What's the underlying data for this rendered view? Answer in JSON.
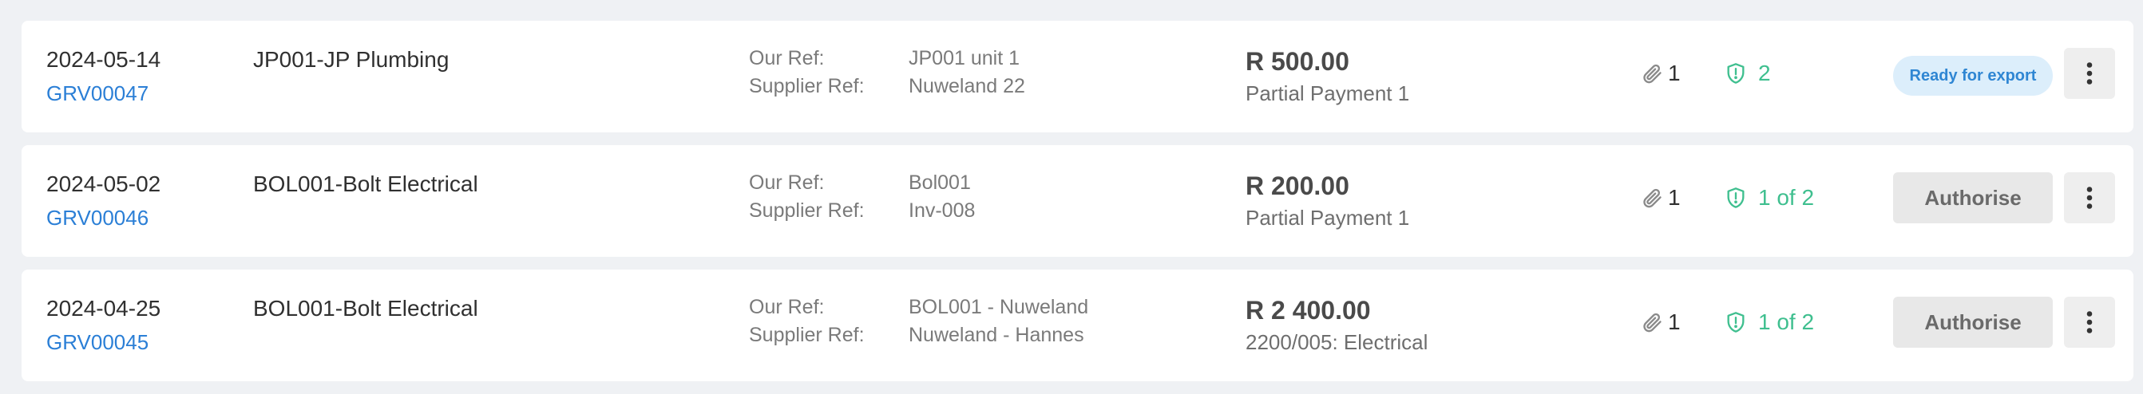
{
  "rows": [
    {
      "date": "2024-05-14",
      "grv": "GRV00047",
      "supplier": "JP001-JP Plumbing",
      "our_ref_label": "Our Ref:",
      "our_ref": "JP001 unit 1",
      "supplier_ref_label": "Supplier Ref:",
      "supplier_ref": "Nuweland 22",
      "amount": "R 500.00",
      "description": "Partial Payment 1",
      "attachments": "1",
      "approvals": "2",
      "status": "Ready for export",
      "icons": {
        "attachment": "paperclip-icon",
        "approval": "shield-icon",
        "more": "vertical-dots-icon"
      }
    },
    {
      "date": "2024-05-02",
      "grv": "GRV00046",
      "supplier": "BOL001-Bolt Electrical",
      "our_ref_label": "Our Ref:",
      "our_ref": "Bol001",
      "supplier_ref_label": "Supplier Ref:",
      "supplier_ref": "Inv-008",
      "amount": "R 200.00",
      "description": "Partial Payment 1",
      "attachments": "1",
      "approvals": "1 of 2",
      "action": "Authorise",
      "icons": {
        "attachment": "paperclip-icon",
        "approval": "shield-icon",
        "more": "vertical-dots-icon"
      }
    },
    {
      "date": "2024-04-25",
      "grv": "GRV00045",
      "supplier": "BOL001-Bolt Electrical",
      "our_ref_label": "Our Ref:",
      "our_ref": "BOL001 - Nuweland",
      "supplier_ref_label": "Supplier Ref:",
      "supplier_ref": "Nuweland - Hannes",
      "amount": "R 2 400.00",
      "description": "2200/005: Electrical",
      "attachments": "1",
      "approvals": "1 of 2",
      "action": "Authorise",
      "icons": {
        "attachment": "paperclip-icon",
        "approval": "shield-icon",
        "more": "vertical-dots-icon"
      }
    }
  ],
  "colors": {
    "link": "#2b7fd6",
    "approval": "#3fbf8f",
    "badge_bg": "#dceefb",
    "badge_text": "#2f86d3",
    "button_bg": "#e8e8e8",
    "page_bg": "#eff1f4"
  }
}
